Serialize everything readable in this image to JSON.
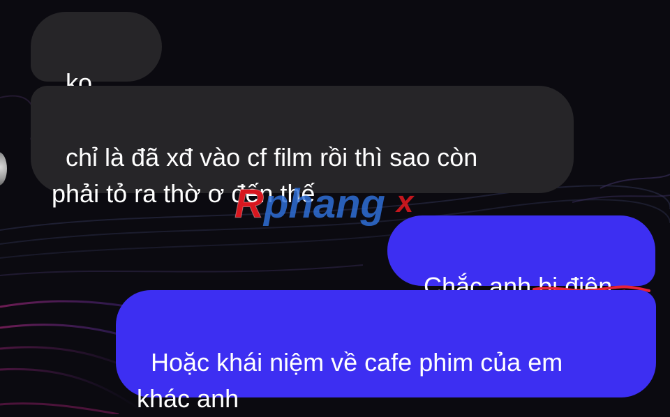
{
  "conversation": {
    "messages": [
      {
        "direction": "incoming",
        "text": "ko hẳn"
      },
      {
        "direction": "incoming",
        "text": "chỉ là đã xđ vào cf film rồi thì sao còn\nphải tỏ ra thờ ơ đến thế"
      },
      {
        "direction": "outgoing",
        "text_before": "Chắc anh ",
        "struck_text": "bị điên"
      },
      {
        "direction": "outgoing",
        "text": "Hoặc khái niệm về cafe phim của em\nkhác anh"
      }
    ]
  },
  "watermark": {
    "text": "Rphangx"
  },
  "colors": {
    "incoming_bubble": "#262528",
    "outgoing_bubble": "#3d2ff2",
    "scribble": "#e6223a",
    "watermark_red": "#d8171f",
    "watermark_blue": "#2f6fd6"
  },
  "icons": {
    "avatar": "avatar-partial"
  }
}
